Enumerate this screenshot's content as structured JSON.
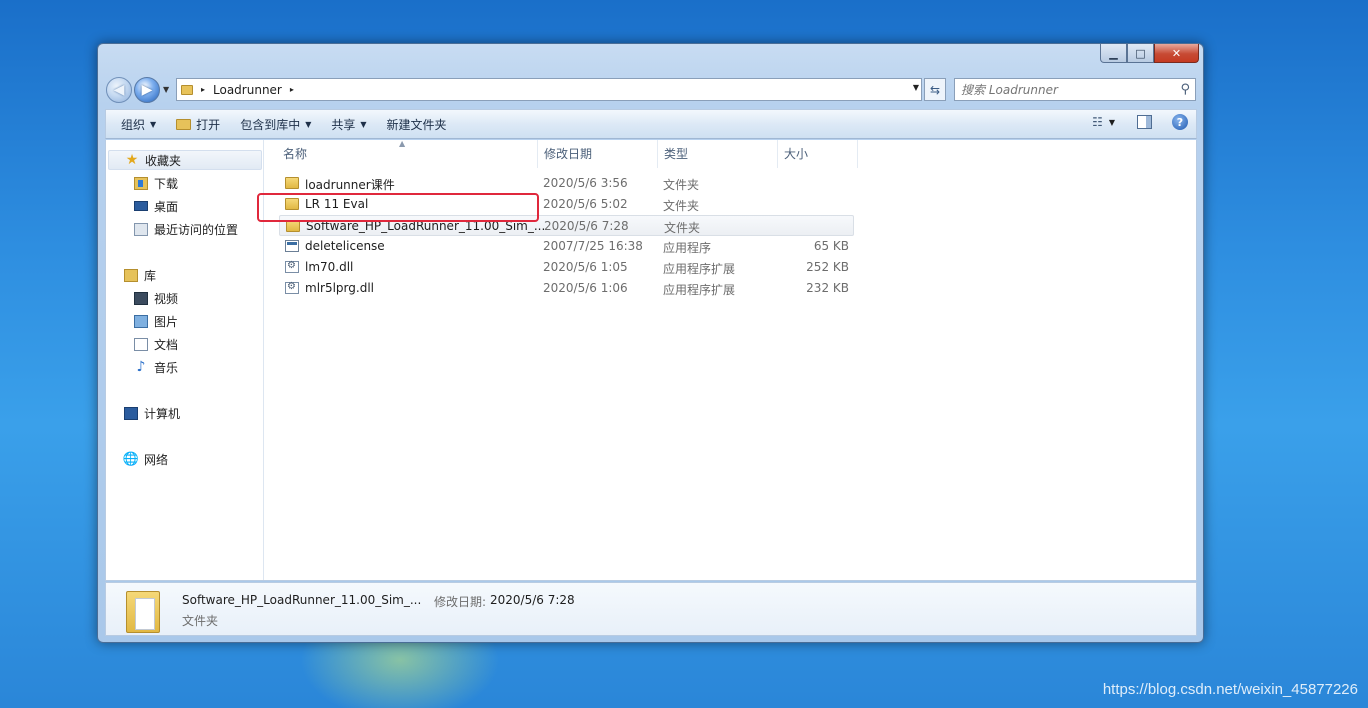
{
  "window": {
    "controls": {
      "minimize": "▁",
      "maximize": "□",
      "close": "✕"
    }
  },
  "address_bar": {
    "path_segment": "Loadrunner",
    "separator": "▸"
  },
  "search": {
    "placeholder": "搜索 Loadrunner"
  },
  "toolbar": {
    "organize": "组织",
    "open": "打开",
    "include_in_library": "包含到库中",
    "share": "共享",
    "new_folder": "新建文件夹"
  },
  "nav_pane": {
    "favorites": "收藏夹",
    "downloads": "下载",
    "desktop": "桌面",
    "recent": "最近访问的位置",
    "libraries": "库",
    "videos": "视频",
    "pictures": "图片",
    "documents": "文档",
    "music": "音乐",
    "computer": "计算机",
    "network": "网络"
  },
  "columns": {
    "name": "名称",
    "date_modified": "修改日期",
    "type": "类型",
    "size": "大小"
  },
  "files": [
    {
      "name": "loadrunner课件",
      "date": "2020/5/6 3:56",
      "type": "文件夹",
      "size": "",
      "kind": "folder"
    },
    {
      "name": "LR 11 Eval",
      "date": "2020/5/6 5:02",
      "type": "文件夹",
      "size": "",
      "kind": "folder"
    },
    {
      "name": "Software_HP_LoadRunner_11.00_Sim_...",
      "date": "2020/5/6 7:28",
      "type": "文件夹",
      "size": "",
      "kind": "folder"
    },
    {
      "name": "deletelicense",
      "date": "2007/7/25 16:38",
      "type": "应用程序",
      "size": "65 KB",
      "kind": "exe"
    },
    {
      "name": "lm70.dll",
      "date": "2020/5/6 1:05",
      "type": "应用程序扩展",
      "size": "252 KB",
      "kind": "dll"
    },
    {
      "name": "mlr5lprg.dll",
      "date": "2020/5/6 1:06",
      "type": "应用程序扩展",
      "size": "232 KB",
      "kind": "dll"
    }
  ],
  "details": {
    "name": "Software_HP_LoadRunner_11.00_Sim_...",
    "date_label": "修改日期:",
    "date": "2020/5/6 7:28",
    "type": "文件夹"
  },
  "watermark": "https://blog.csdn.net/weixin_45877226",
  "colors": {
    "highlight_box": "#e0283c",
    "desktop_blue": "#2e8ee0"
  }
}
